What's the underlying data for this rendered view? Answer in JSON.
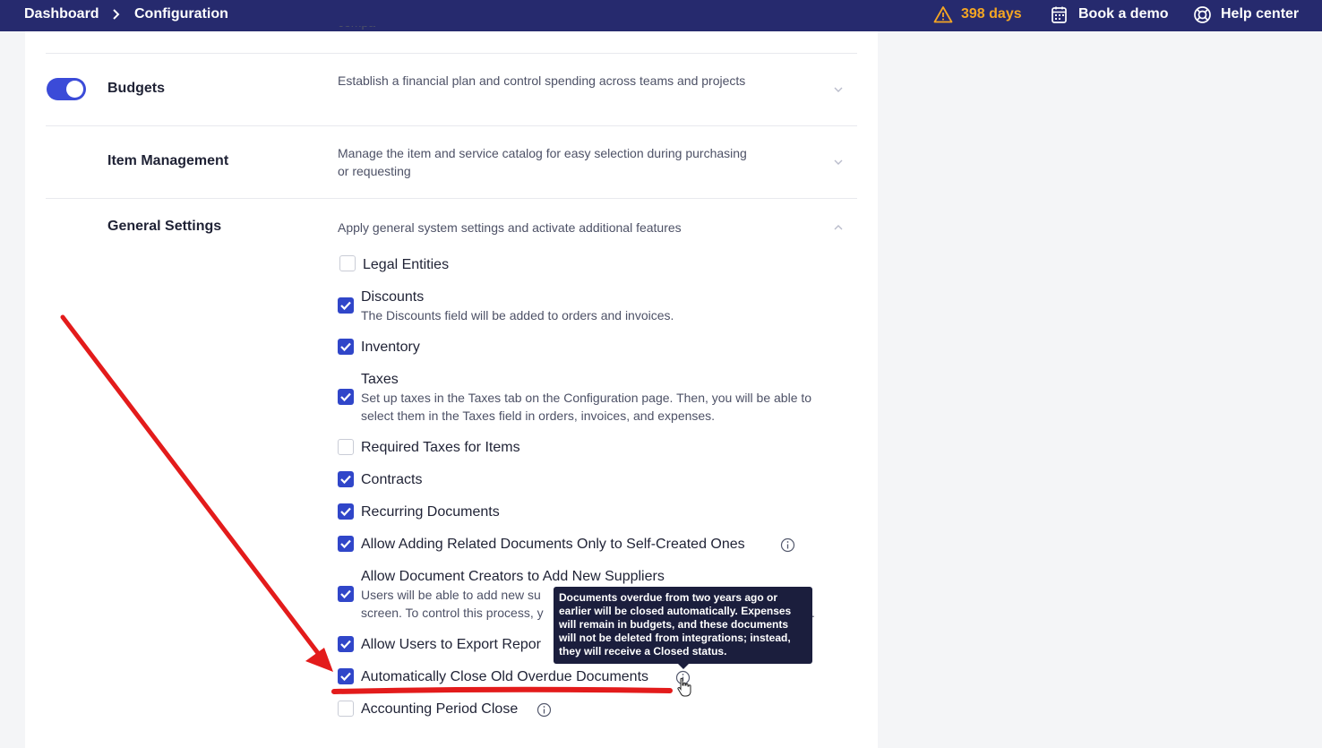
{
  "header": {
    "breadcrumb": [
      "Dashboard",
      "Configuration"
    ],
    "trial_days": "398 days",
    "book_demo": "Book a demo",
    "help_center": "Help center",
    "icons": [
      "warning-icon",
      "calendar-icon",
      "lifebuoy-icon",
      "chevron-right-icon"
    ]
  },
  "sections": {
    "budgets": {
      "title": "Budgets",
      "description": "Establish a financial plan and control spending across teams and projects",
      "enabled": true
    },
    "item_management": {
      "title": "Item Management",
      "description": "Manage the item and service catalog for easy selection during purchasing or requesting"
    },
    "general_settings": {
      "title": "General Settings",
      "description": "Apply general system settings and activate additional features"
    }
  },
  "options": [
    {
      "label": "Legal Entities",
      "checked": false
    },
    {
      "label": "Discounts",
      "sub": "The Discounts field will be added to orders and invoices.",
      "checked": true
    },
    {
      "label": "Inventory",
      "checked": true
    },
    {
      "label": "Taxes",
      "sub": "Set up taxes in the Taxes tab on the Configuration page. Then, you will be able to select them in the Taxes field in orders, invoices, and expenses.",
      "checked": true
    },
    {
      "label": "Required Taxes for Items",
      "checked": false
    },
    {
      "label": "Contracts",
      "checked": true
    },
    {
      "label": "Recurring Documents",
      "checked": true
    },
    {
      "label": "Allow Adding Related Documents Only to Self-Created Ones",
      "checked": true,
      "info": true
    },
    {
      "label": "Allow Document Creators to Add New Suppliers",
      "sub": "Users will be able to add new su",
      "sub2": "screen. To control this process, y",
      "sub2_tail": ".",
      "checked": true
    },
    {
      "label": "Allow Users to Export Repor",
      "checked": true
    },
    {
      "label": "Automatically Close Old Overdue Documents",
      "checked": true,
      "info": true
    },
    {
      "label": "Accounting Period Close",
      "checked": false,
      "info": true
    }
  ],
  "tooltip": {
    "text": "Documents overdue from two years ago or earlier will be closed automatically. Expenses will remain in budgets, and these documents will not be deleted from integrations; instead, they will receive a Closed status."
  },
  "colors": {
    "topbar": "#262a6e",
    "accent": "#3046c9",
    "warning": "#f5a623",
    "annotation": "#e31b1b"
  }
}
